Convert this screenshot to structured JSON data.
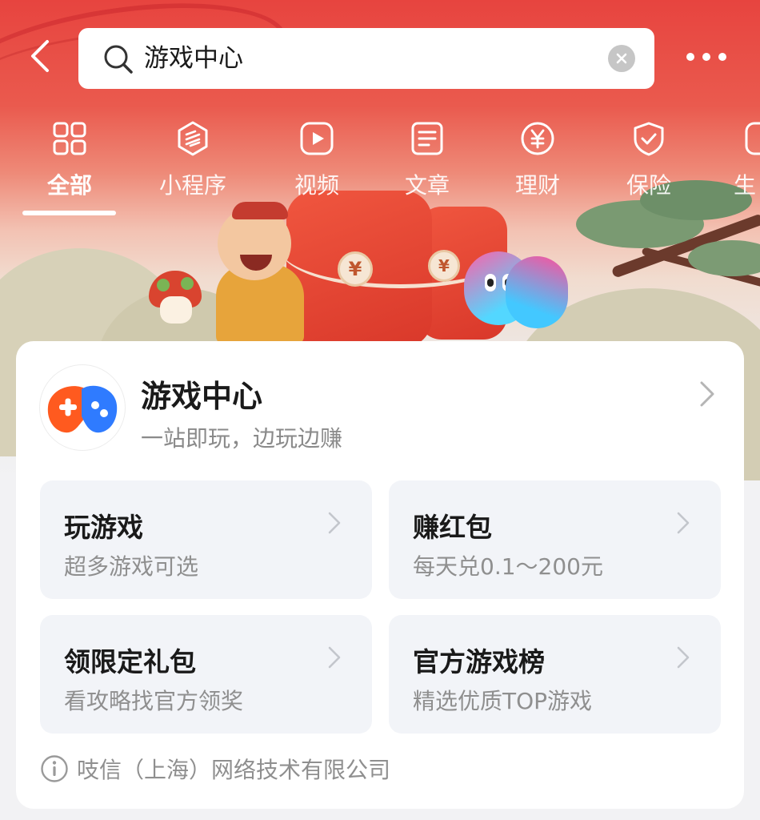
{
  "search": {
    "query": "游戏中心"
  },
  "tabs": [
    {
      "label": "全部",
      "icon": "grid-icon",
      "active": true
    },
    {
      "label": "小程序",
      "icon": "mini-program-icon",
      "active": false
    },
    {
      "label": "视频",
      "icon": "video-icon",
      "active": false
    },
    {
      "label": "文章",
      "icon": "article-icon",
      "active": false
    },
    {
      "label": "理财",
      "icon": "yuan-icon",
      "active": false
    },
    {
      "label": "保险",
      "icon": "shield-icon",
      "active": false
    },
    {
      "label": "生",
      "icon": "partial-icon",
      "active": false
    }
  ],
  "card": {
    "title": "游戏中心",
    "subtitle": "一站即玩，边玩边赚",
    "tiles": [
      {
        "title": "玩游戏",
        "subtitle": "超多游戏可选"
      },
      {
        "title": "赚红包",
        "subtitle": "每天兑0.1～200元"
      },
      {
        "title": "领限定礼包",
        "subtitle": "看攻略找官方领奖"
      },
      {
        "title": "官方游戏榜",
        "subtitle": "精选优质TOP游戏"
      }
    ],
    "company": "吱信（上海）网络技术有限公司"
  },
  "colors": {
    "banner_red": "#e7443f",
    "logo_orange": "#ff5a1f",
    "logo_blue": "#2f7bff",
    "tile_bg": "#f2f4f8"
  }
}
